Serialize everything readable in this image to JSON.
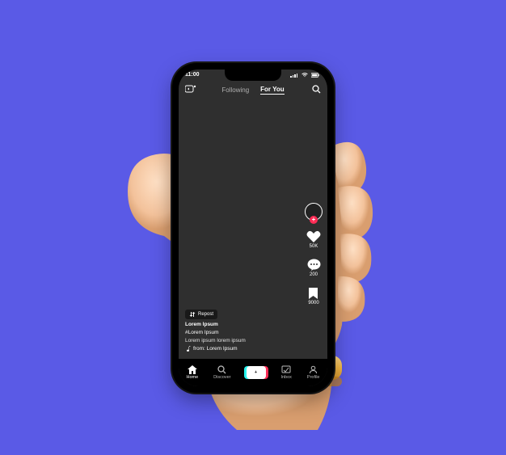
{
  "status": {
    "time": "11:00"
  },
  "top": {
    "following": "Following",
    "foryou": "For You"
  },
  "rail": {
    "likes": "50K",
    "comments": "200",
    "saves": "9000"
  },
  "caption": {
    "repost": "Repost",
    "line1": "Lorem Ipsum",
    "line2": "#Lorem Ipsum",
    "desc": "Lorem ipsum lorem ipsum",
    "sound": "from: Lorem Ipsum"
  },
  "nav": {
    "home": "Home",
    "discover": "Discover",
    "inbox": "Inbox",
    "profile": "Profile"
  }
}
